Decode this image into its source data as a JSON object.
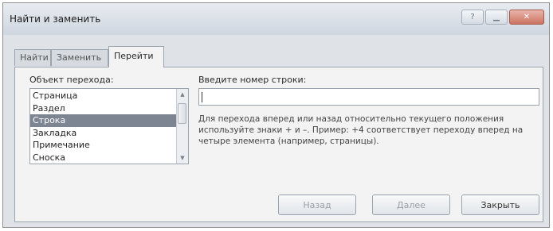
{
  "window": {
    "title": "Найти и заменить"
  },
  "tabs": [
    {
      "label": "Найти"
    },
    {
      "label": "Заменить"
    },
    {
      "label": "Перейти"
    }
  ],
  "goto": {
    "list_label": "Объект перехода:",
    "list_items": [
      "Страница",
      "Раздел",
      "Строка",
      "Закладка",
      "Примечание",
      "Сноска"
    ],
    "selected_item": "Строка",
    "input_label": "Введите номер строки:",
    "input_value": "",
    "help_text": "Для перехода вперед или назад относительно текущего положения используйте знаки + и –. Пример: +4 соответствует переходу вперед на четыре элемента (например, страницы)."
  },
  "buttons": {
    "back": "Назад",
    "next": "Далее",
    "close": "Закрыть"
  }
}
